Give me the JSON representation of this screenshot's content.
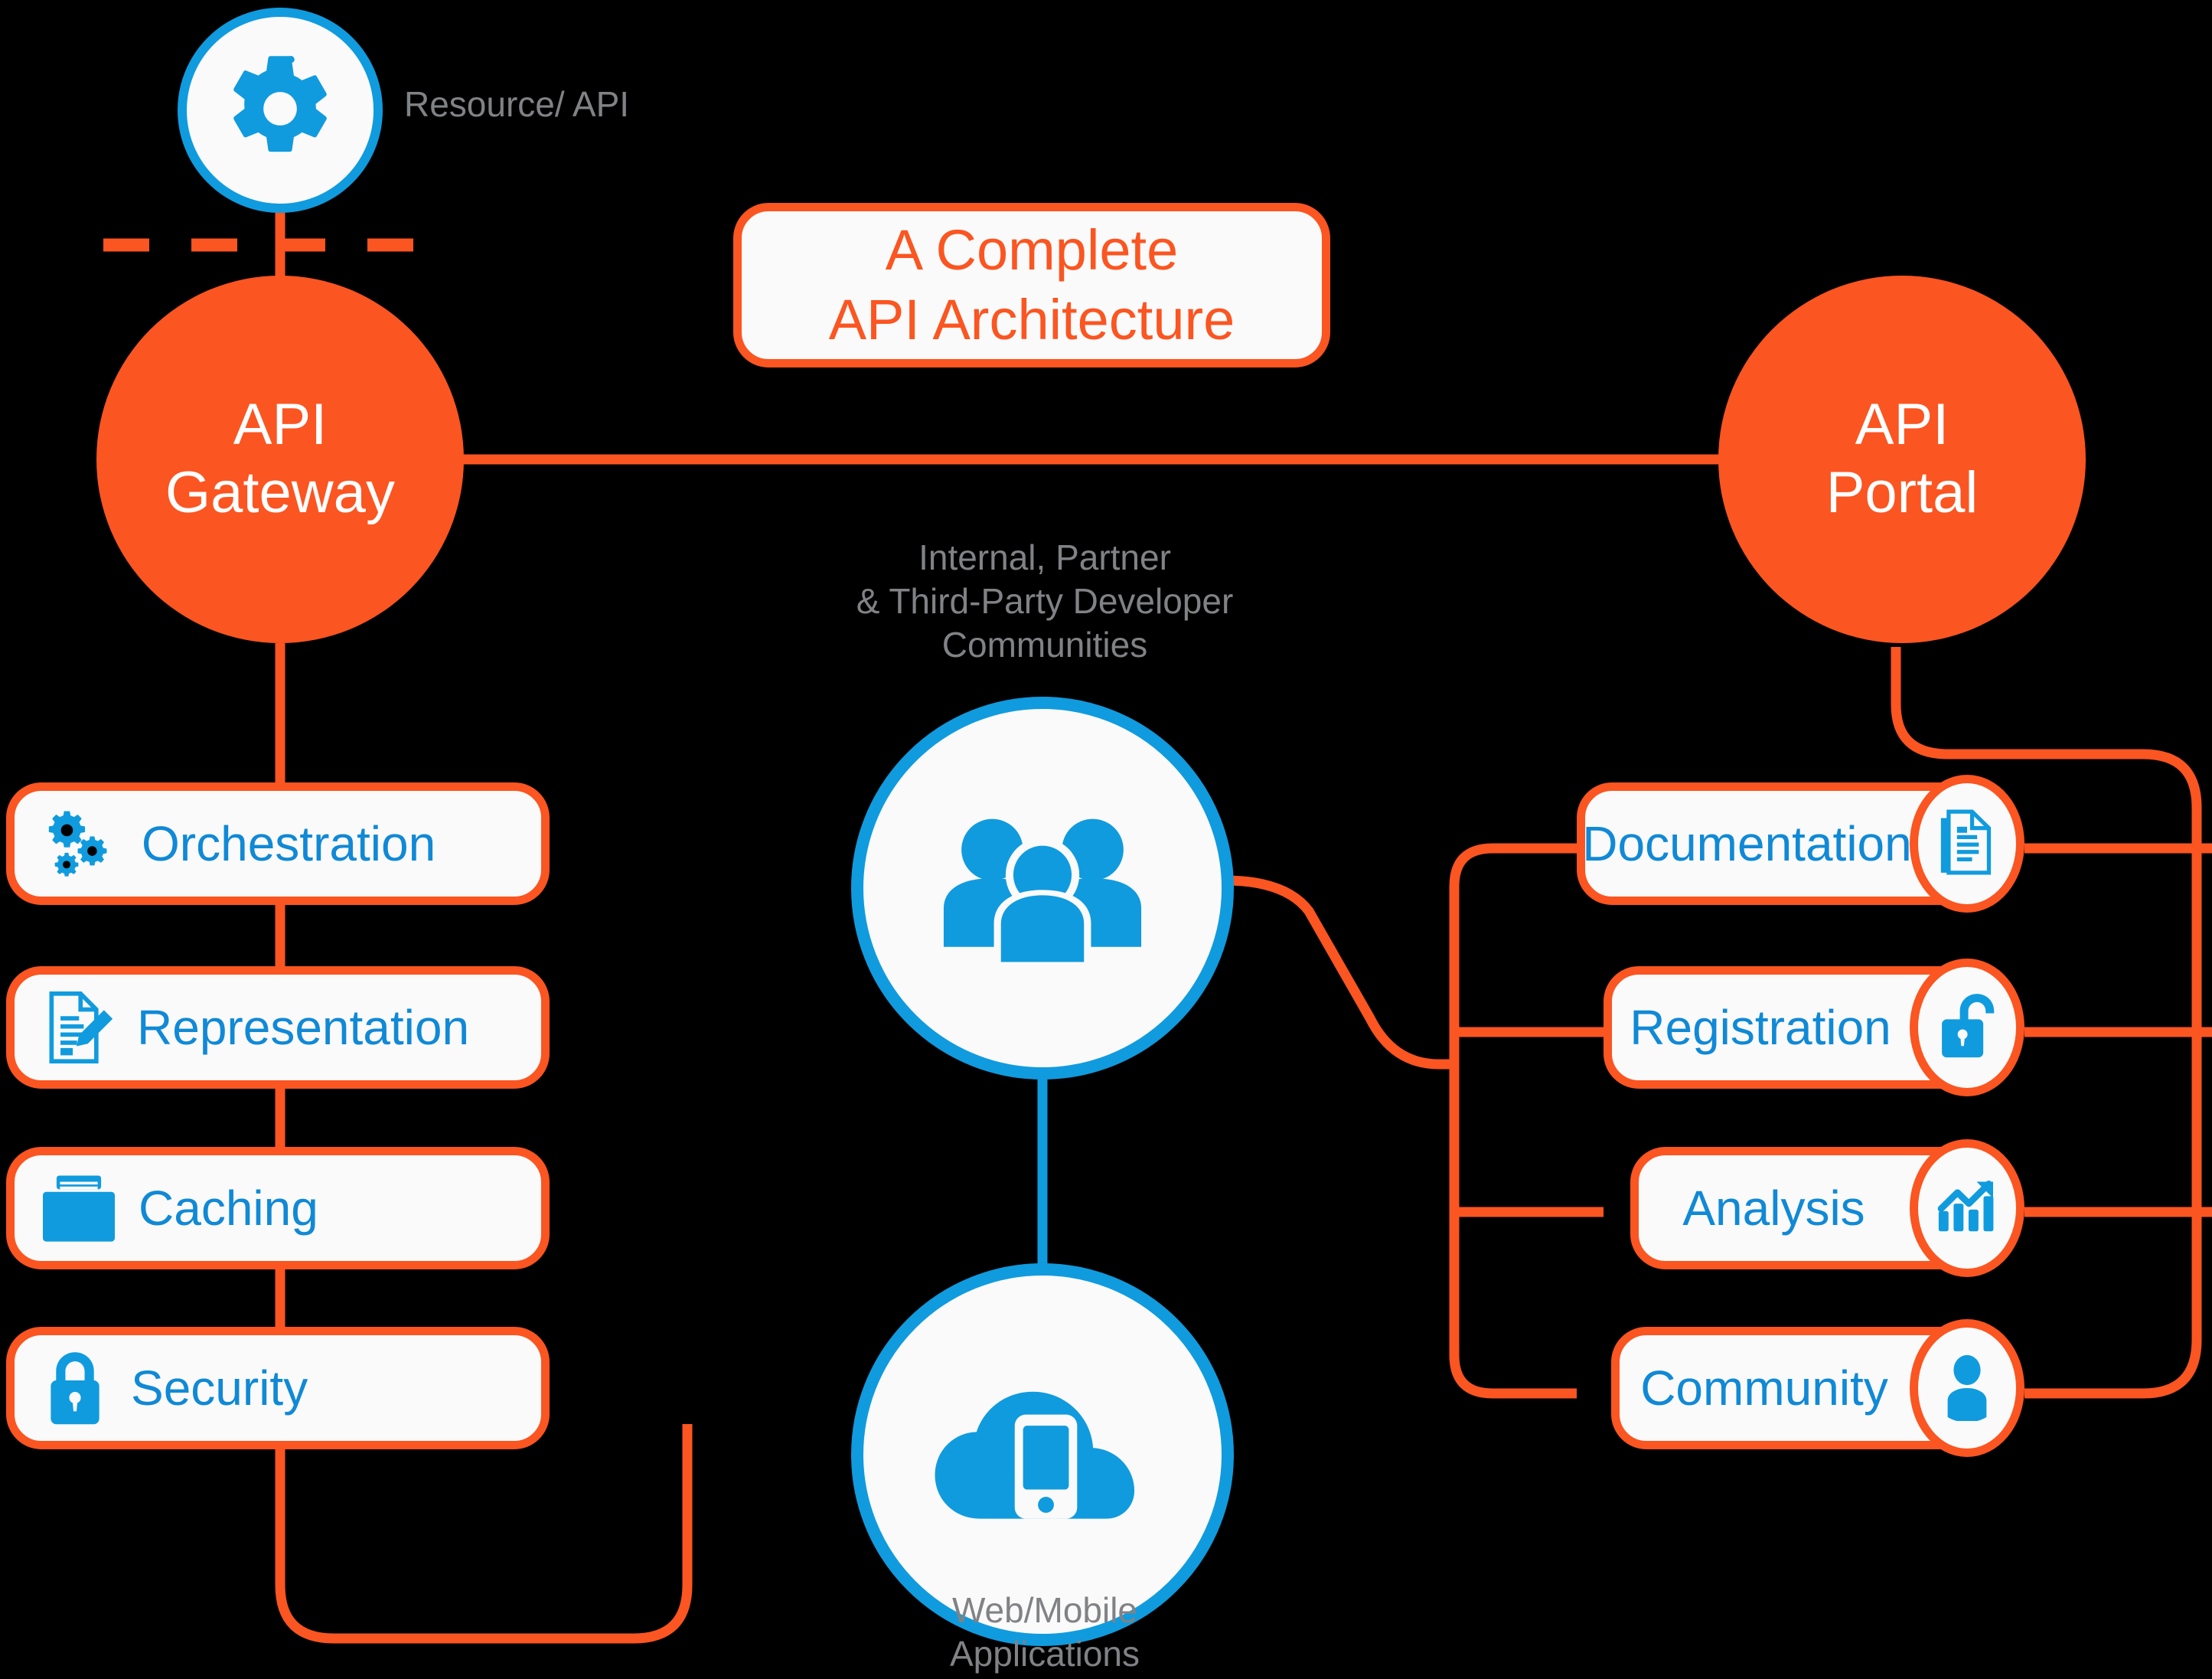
{
  "diagram": {
    "title_box": {
      "line1": "A Complete",
      "line2": "API Architecture"
    },
    "resource_label": "Resource/ API",
    "gateway": {
      "line1": "API",
      "line2": "Gateway"
    },
    "portal": {
      "line1": "API",
      "line2": "Portal"
    },
    "developer_caption": "Internal, Partner\n& Third-Party Developer\nCommunities",
    "apps_caption": "Web/Mobile\nApplications",
    "gateway_capabilities": [
      {
        "label": "Orchestration",
        "icon": "gears-icon"
      },
      {
        "label": "Representation",
        "icon": "document-pencil-icon"
      },
      {
        "label": "Caching",
        "icon": "folder-icon"
      },
      {
        "label": "Security",
        "icon": "padlock-closed-icon"
      }
    ],
    "portal_features": [
      {
        "label": "Documentation",
        "icon": "document-icon"
      },
      {
        "label": "Registration",
        "icon": "padlock-open-icon"
      },
      {
        "label": "Analysis",
        "icon": "bar-chart-arrow-icon"
      },
      {
        "label": "Community",
        "icon": "person-icon"
      }
    ],
    "icons": {
      "top_node": "gear-icon",
      "developers": "people-group-icon",
      "applications": "cloud-mobile-icon"
    },
    "colors": {
      "orange": "#FB5521",
      "blue": "#109BDE",
      "text_blue": "#1089D6",
      "gray": "#808285",
      "white": "#FAFAFA",
      "background": "#000000"
    }
  }
}
